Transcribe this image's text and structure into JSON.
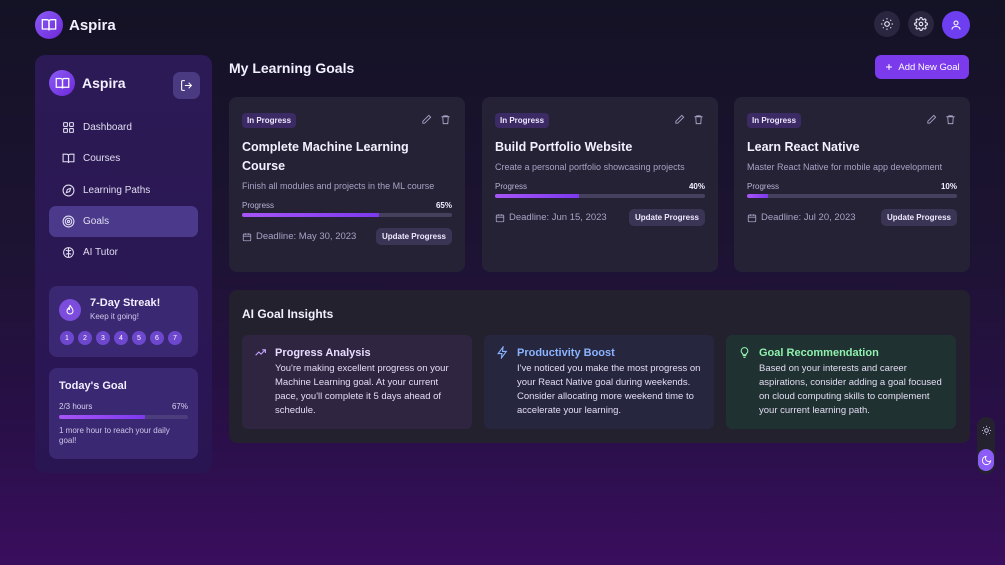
{
  "app": {
    "name": "Aspira"
  },
  "sidebar": {
    "title": "Aspira",
    "items": [
      {
        "label": "Dashboard",
        "icon": "grid-icon"
      },
      {
        "label": "Courses",
        "icon": "book-icon"
      },
      {
        "label": "Learning Paths",
        "icon": "compass-icon"
      },
      {
        "label": "Goals",
        "icon": "target-icon",
        "active": true
      },
      {
        "label": "AI Tutor",
        "icon": "brain-icon"
      }
    ],
    "streak": {
      "title": "7-Day Streak!",
      "subtitle": "Keep it going!",
      "days": [
        "1",
        "2",
        "3",
        "4",
        "5",
        "6",
        "7"
      ]
    },
    "today_goal": {
      "title": "Today's Goal",
      "hours": "2/3 hours",
      "percent_label": "67%",
      "progress": 0.67,
      "note": "1 more hour to reach your daily goal!"
    }
  },
  "main": {
    "title": "My Learning Goals",
    "add_button": "Add New Goal",
    "goals": [
      {
        "status": "In Progress",
        "title": "Complete Machine Learning Course",
        "description": "Finish all modules and projects in the ML course",
        "progress_label": "Progress",
        "percent_label": "65%",
        "progress": 0.65,
        "deadline": "Deadline: May 30, 2023",
        "update_label": "Update Progress"
      },
      {
        "status": "In Progress",
        "title": "Build Portfolio Website",
        "description": "Create a personal portfolio showcasing projects",
        "progress_label": "Progress",
        "percent_label": "40%",
        "progress": 0.4,
        "deadline": "Deadline: Jun 15, 2023",
        "update_label": "Update Progress"
      },
      {
        "status": "In Progress",
        "title": "Learn React Native",
        "description": "Master React Native for mobile app development",
        "progress_label": "Progress",
        "percent_label": "10%",
        "progress": 0.1,
        "deadline": "Deadline: Jul 20, 2023",
        "update_label": "Update Progress"
      }
    ],
    "insights": {
      "title": "AI Goal Insights",
      "cards": [
        {
          "title": "Progress Analysis",
          "icon": "trending-up-icon",
          "text": "You're making excellent progress on your Machine Learning goal. At your current pace, you'll complete it 5 days ahead of schedule."
        },
        {
          "title": "Productivity Boost",
          "icon": "lightning-icon",
          "text": "I've noticed you make the most progress on your React Native goal during weekends. Consider allocating more weekend time to accelerate your learning."
        },
        {
          "title": "Goal Recommendation",
          "icon": "lightbulb-icon",
          "text": "Based on your interests and career aspirations, consider adding a goal focused on cloud computing skills to complement your current learning path."
        }
      ]
    }
  },
  "colors": {
    "accent": "#7c3aed",
    "progress_fill": "#a855f7",
    "insight_blue": "#8ab4ff",
    "insight_green": "#8ff0ad"
  }
}
